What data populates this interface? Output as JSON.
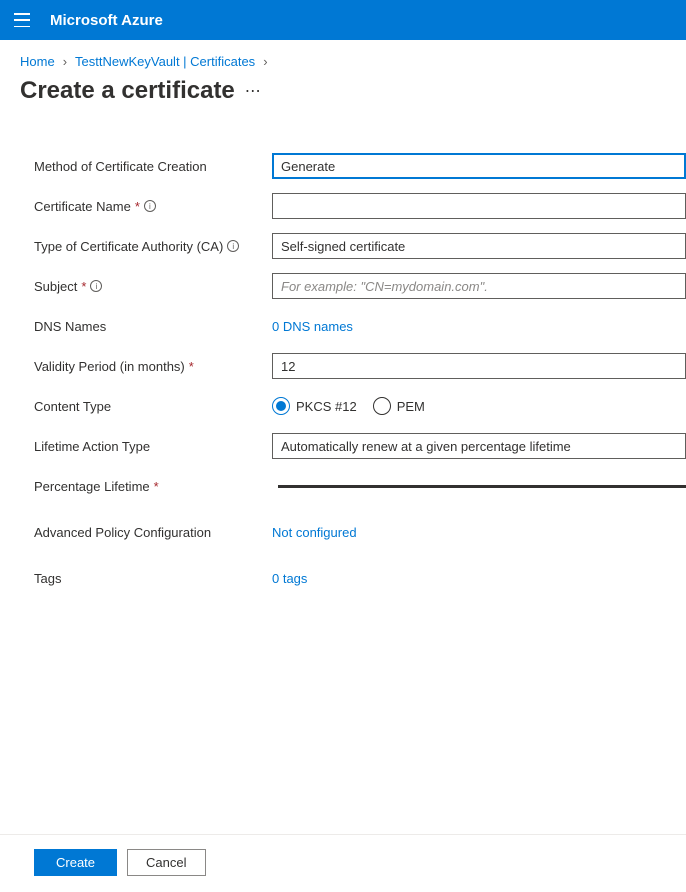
{
  "topbar": {
    "brand": "Microsoft Azure"
  },
  "breadcrumbs": {
    "items": [
      {
        "label": "Home"
      },
      {
        "label": "TesttNewKeyVault | Certificates"
      }
    ]
  },
  "page": {
    "title": "Create a certificate"
  },
  "form": {
    "method": {
      "label": "Method of Certificate Creation",
      "value": "Generate"
    },
    "certName": {
      "label": "Certificate Name",
      "value": ""
    },
    "caType": {
      "label": "Type of Certificate Authority (CA)",
      "value": "Self-signed certificate"
    },
    "subject": {
      "label": "Subject",
      "placeholder": "For example: \"CN=mydomain.com\"."
    },
    "dnsNames": {
      "label": "DNS Names",
      "linkText": "0 DNS names"
    },
    "validity": {
      "label": "Validity Period (in months)",
      "value": "12"
    },
    "contentType": {
      "label": "Content Type",
      "options": [
        "PKCS #12",
        "PEM"
      ],
      "selected": "PKCS #12"
    },
    "lifetimeAction": {
      "label": "Lifetime Action Type",
      "value": "Automatically renew at a given percentage lifetime"
    },
    "pctLifetime": {
      "label": "Percentage Lifetime"
    },
    "advanced": {
      "label": "Advanced Policy Configuration",
      "linkText": "Not configured"
    },
    "tags": {
      "label": "Tags",
      "linkText": "0 tags"
    }
  },
  "footer": {
    "create": "Create",
    "cancel": "Cancel"
  }
}
